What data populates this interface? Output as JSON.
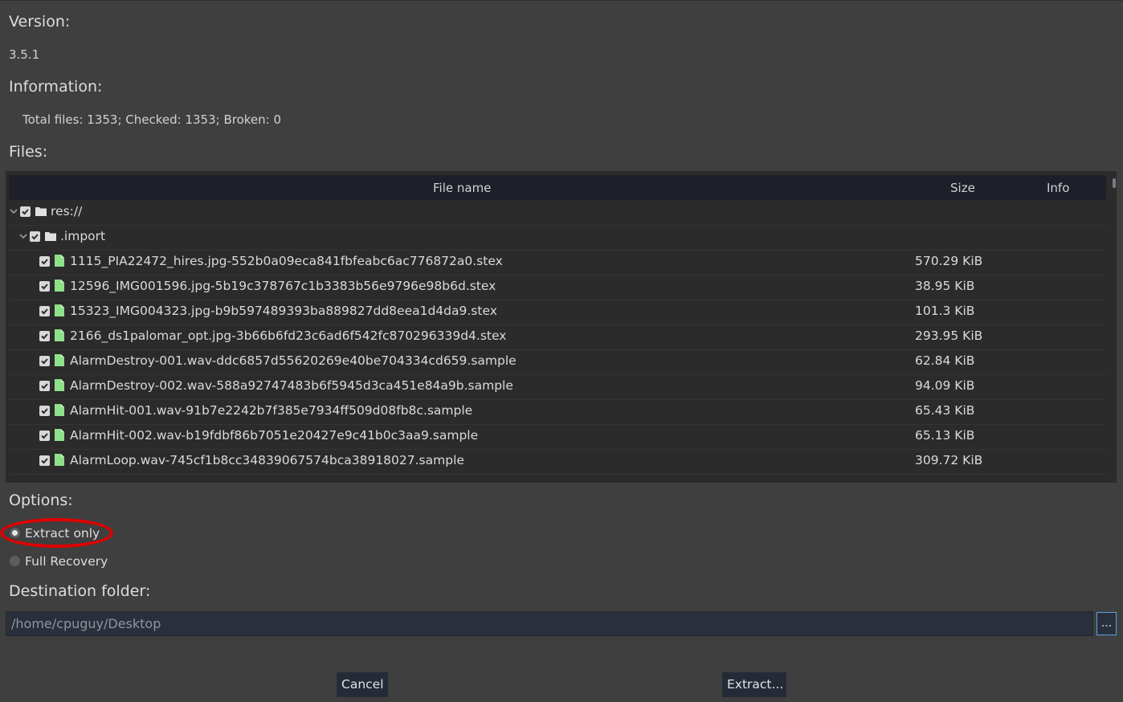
{
  "version": {
    "heading": "Version:",
    "value": "3.5.1"
  },
  "information": {
    "heading": "Information:",
    "value": "Total files: 1353; Checked: 1353; Broken: 0"
  },
  "files": {
    "heading": "Files:",
    "columns": {
      "name": "File name",
      "size": "Size",
      "info": "Info"
    },
    "root": {
      "name": "res://",
      "checked": true,
      "expanded": true
    },
    "folder": {
      "name": ".import",
      "checked": true,
      "expanded": true
    },
    "rows": [
      {
        "name": "1115_PIA22472_hires.jpg-552b0a09eca841fbfeabc6ac776872a0.stex",
        "size": "570.29 KiB"
      },
      {
        "name": "12596_IMG001596.jpg-5b19c378767c1b3383b56e9796e98b6d.stex",
        "size": "38.95 KiB"
      },
      {
        "name": "15323_IMG004323.jpg-b9b597489393ba889827dd8eea1d4da9.stex",
        "size": "101.3 KiB"
      },
      {
        "name": "2166_ds1palomar_opt.jpg-3b66b6fd23c6ad6f542fc870296339d4.stex",
        "size": "293.95 KiB"
      },
      {
        "name": "AlarmDestroy-001.wav-ddc6857d55620269e40be704334cd659.sample",
        "size": "62.84 KiB"
      },
      {
        "name": "AlarmDestroy-002.wav-588a92747483b6f5945d3ca451e84a9b.sample",
        "size": "94.09 KiB"
      },
      {
        "name": "AlarmHit-001.wav-91b7e2242b7f385e7934ff509d08fb8c.sample",
        "size": "65.43 KiB"
      },
      {
        "name": "AlarmHit-002.wav-b19fdbf86b7051e20427e9c41b0c3aa9.sample",
        "size": "65.13 KiB"
      },
      {
        "name": "AlarmLoop.wav-745cf1b8cc34839067574bca38918027.sample",
        "size": "309.72 KiB"
      }
    ]
  },
  "options": {
    "heading": "Options:",
    "extract_only": "Extract only",
    "full_recovery": "Full Recovery",
    "selected": "Extract only"
  },
  "destination": {
    "heading": "Destination folder:",
    "value": "/home/cpuguy/Desktop",
    "browse_label": "..."
  },
  "buttons": {
    "cancel": "Cancel",
    "extract": "Extract..."
  },
  "colors": {
    "file_icon": "#8fe08a",
    "highlight": "#e00000",
    "accent": "#5aa0e0"
  }
}
